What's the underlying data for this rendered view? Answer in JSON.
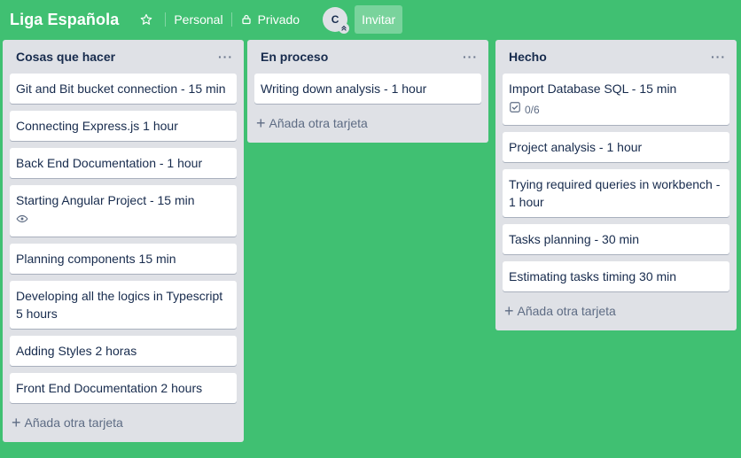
{
  "header": {
    "board_title": "Liga Española",
    "visibility_team": "Personal",
    "visibility_privacy": "Privado",
    "avatar_initial": "C",
    "invite_label": "Invitar"
  },
  "add_card_label": "Añada otra tarjeta",
  "lists": [
    {
      "title": "Cosas que hacer",
      "cards": [
        "Git and Bit bucket connection - 15 min",
        "Connecting Express.js 1 hour",
        "Back End Documentation - 1 hour",
        "Starting Angular Project - 15 min",
        "Planning components 15 min",
        "Developing all the logics in Typescript 5 hours",
        "Adding Styles 2 horas",
        "Front End Documentation 2 hours"
      ]
    },
    {
      "title": "En proceso",
      "cards": [
        "Writing down analysis - 1 hour"
      ]
    },
    {
      "title": "Hecho",
      "cards": [
        "Import Database SQL - 15 min",
        "Project analysis - 1 hour",
        "Trying required queries in workbench - 1 hour",
        "Tasks planning - 30 min",
        "Estimating tasks timing 30 min"
      ],
      "checklist_badge": "0/6"
    }
  ],
  "colors": {
    "board_bg": "#40c072",
    "list_bg": "#dfe1e6",
    "card_bg": "#ffffff"
  }
}
